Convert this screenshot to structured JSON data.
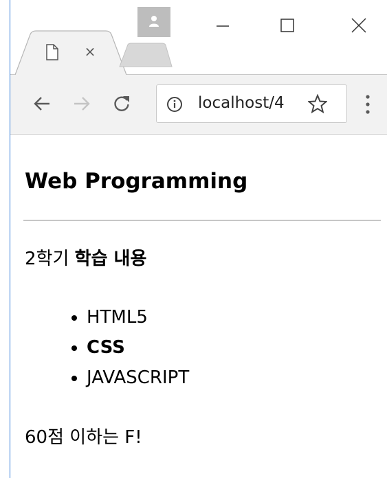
{
  "browser": {
    "tab": {
      "title": "",
      "close_glyph": "×"
    },
    "address_bar": {
      "url": "localhost/4"
    },
    "icons": {
      "profile": "profile-icon",
      "minimize": "minimize-icon",
      "maximize": "maximize-icon",
      "close": "close-icon",
      "back": "back-arrow-icon",
      "forward": "forward-arrow-icon",
      "reload": "reload-icon",
      "info": "info-icon",
      "bookmark": "star-icon",
      "menu": "kebab-menu-icon",
      "page": "page-icon"
    },
    "colors": {
      "toolbar_bg": "#f2f2f2",
      "window_edge": "#2b78d8",
      "profile_bg": "#bdbdbd"
    }
  },
  "page": {
    "heading": "Web Programming",
    "intro_prefix": "2학기 ",
    "intro_bold": "학습 내용",
    "list": [
      {
        "label": "HTML5",
        "bold": false
      },
      {
        "label": "CSS",
        "bold": true
      },
      {
        "label": "JAVASCRIPT",
        "bold": false
      }
    ],
    "note": "60점 이하는 F!"
  }
}
